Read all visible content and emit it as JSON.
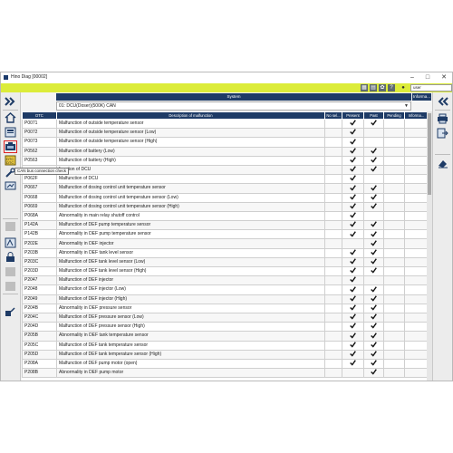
{
  "window": {
    "title": "Hino Diag [00002]",
    "user_label": "user"
  },
  "colors": {
    "menubar": "#dcec3a",
    "header": "#1e3b66",
    "check": "#111111"
  },
  "tooltip": "CAN bus connection check",
  "system": {
    "header": "System",
    "info_header": "Informa...",
    "selected": "01: DCU(Doser)(500K) CAN"
  },
  "columns": [
    "DTC",
    "Description of malfunction",
    "No sel...",
    "Present",
    "Past",
    "Pending",
    "Informa..."
  ],
  "rows": [
    {
      "dtc": "P0071",
      "desc": "Malfunction of outside temperature sensor",
      "present": true,
      "past": true
    },
    {
      "dtc": "P0072",
      "desc": "Malfunction of outside temperature sensor (Low)",
      "present": true,
      "past": false
    },
    {
      "dtc": "P0073",
      "desc": "Malfunction of outside temperature sensor (High)",
      "present": true,
      "past": false
    },
    {
      "dtc": "P0562",
      "desc": "Malfunction of battery (Low)",
      "present": true,
      "past": true
    },
    {
      "dtc": "P0563",
      "desc": "Malfunction of battery (High)",
      "present": true,
      "past": true
    },
    {
      "dtc": "",
      "desc": "function of DCU",
      "present": true,
      "past": true
    },
    {
      "dtc": "P062F",
      "desc": "Malfunction of DCU",
      "present": true,
      "past": false
    },
    {
      "dtc": "P0667",
      "desc": "Malfunction of dosing control unit temperature sensor",
      "present": true,
      "past": true
    },
    {
      "dtc": "P0668",
      "desc": "Malfunction of dosing control unit temperature sensor (Low)",
      "present": true,
      "past": true
    },
    {
      "dtc": "P0669",
      "desc": "Malfunction of dosing control unit temperature sensor (High)",
      "present": true,
      "past": true
    },
    {
      "dtc": "P068A",
      "desc": "Abnormality in main relay shutoff control",
      "present": true,
      "past": false
    },
    {
      "dtc": "P142A",
      "desc": "Malfunction of DEF pump temperature sensor",
      "present": true,
      "past": true
    },
    {
      "dtc": "P142B",
      "desc": "Abnormality in DEF pump temperature sensor",
      "present": true,
      "past": true
    },
    {
      "dtc": "P202E",
      "desc": "Abnormality in DEF injector",
      "present": false,
      "past": true
    },
    {
      "dtc": "P203B",
      "desc": "Abnormality in DEF tank level sensor",
      "present": true,
      "past": true
    },
    {
      "dtc": "P203C",
      "desc": "Malfunction of DEF tank level sensor (Low)",
      "present": true,
      "past": true
    },
    {
      "dtc": "P203D",
      "desc": "Malfunction of DEF tank level sensor (High)",
      "present": true,
      "past": true
    },
    {
      "dtc": "P2047",
      "desc": "Malfunction of DEF injector",
      "present": true,
      "past": false
    },
    {
      "dtc": "P2048",
      "desc": "Malfunction of DEF injector (Low)",
      "present": true,
      "past": true
    },
    {
      "dtc": "P2049",
      "desc": "Malfunction of DEF injector (High)",
      "present": true,
      "past": true
    },
    {
      "dtc": "P204B",
      "desc": "Abnormality in DEF pressure sensor",
      "present": true,
      "past": true
    },
    {
      "dtc": "P204C",
      "desc": "Malfunction of DEF pressure sensor (Low)",
      "present": true,
      "past": true
    },
    {
      "dtc": "P204D",
      "desc": "Malfunction of DEF pressure sensor (High)",
      "present": true,
      "past": true
    },
    {
      "dtc": "P205B",
      "desc": "Abnormality in DEF tank temperature sensor",
      "present": true,
      "past": true
    },
    {
      "dtc": "P205C",
      "desc": "Malfunction of DEF tank temperature sensor",
      "present": true,
      "past": true
    },
    {
      "dtc": "P205D",
      "desc": "Malfunction of DEF tank temperature sensor (High)",
      "present": true,
      "past": true
    },
    {
      "dtc": "P208A",
      "desc": "Malfunction of DEF pump motor (open)",
      "present": true,
      "past": true
    },
    {
      "dtc": "P208B",
      "desc": "Abnormality in DEF pump motor",
      "present": false,
      "past": true
    }
  ]
}
